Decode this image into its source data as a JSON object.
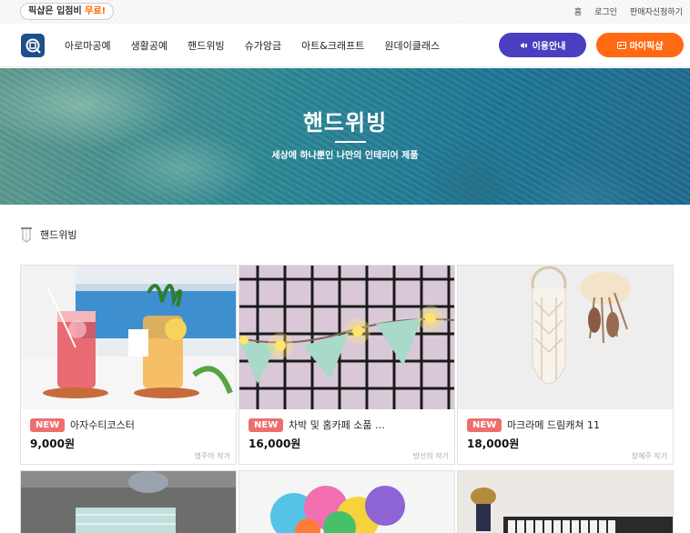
{
  "topbar": {
    "promo_prefix": "픽샵은 입점비 ",
    "promo_highlight": "무료!",
    "links": [
      "홈",
      "로그인",
      "판매자신청하기"
    ]
  },
  "header": {
    "logo_icon": "pixshop-logo-icon",
    "nav": [
      "아로마공예",
      "생활공예",
      "핸드위빙",
      "슈가앙금",
      "아트&크래프트",
      "원데이클래스"
    ],
    "guide_button": "이용안내",
    "my_button": "마이픽샵",
    "colors": {
      "guide": "#4a3fc0",
      "my": "#ff6a13"
    }
  },
  "hero": {
    "title": "핸드위빙",
    "subtitle": "세상에 하나뿐인 나만의 인테리어 제품"
  },
  "breadcrumb": {
    "label": "핸드위빙"
  },
  "products": [
    {
      "badge": "NEW",
      "name": "아자수티코스터",
      "price": "9,000원",
      "author": "명주아 작가"
    },
    {
      "badge": "NEW",
      "name": "차박 및 홈카페 소품 …",
      "price": "16,000원",
      "author": "방선희 작가"
    },
    {
      "badge": "NEW",
      "name": "마크라메 드림캐쳐 11",
      "price": "18,000원",
      "author": "장혜주 작가"
    }
  ],
  "badge_color": "#ee6e6e"
}
